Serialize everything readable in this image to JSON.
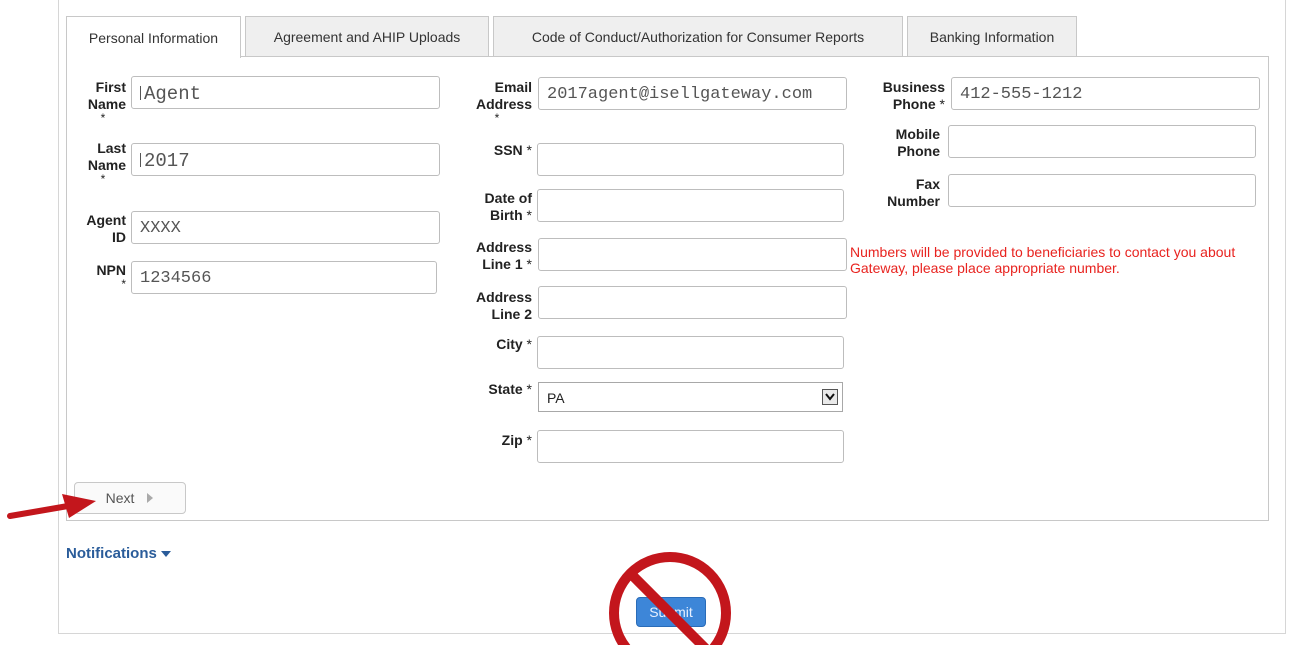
{
  "tabs": [
    {
      "label": "Personal Information",
      "active": true
    },
    {
      "label": "Agreement and AHIP Uploads",
      "active": false
    },
    {
      "label": "Code of Conduct/Authorization for Consumer Reports",
      "active": false
    },
    {
      "label": "Banking Information",
      "active": false
    }
  ],
  "form": {
    "first_name": {
      "label_1": "First",
      "label_2": "Name",
      "required": "*",
      "value": "Agent"
    },
    "last_name": {
      "label_1": "Last",
      "label_2": "Name",
      "required": "*",
      "value": "2017"
    },
    "agent_id": {
      "label_1": "Agent",
      "label_2": "ID",
      "value": "XXXX"
    },
    "npn": {
      "label_1": "NPN",
      "required": "*",
      "value": "1234566"
    },
    "email": {
      "label_1": "Email",
      "label_2": "Address",
      "required": "*",
      "value": "2017agent@isellgateway.com"
    },
    "ssn": {
      "label": "SSN",
      "required": "*",
      "value": ""
    },
    "dob": {
      "label_1": "Date of",
      "label_2": "Birth",
      "required": "*",
      "value": ""
    },
    "address1": {
      "label_1": "Address",
      "label_2": "Line 1",
      "required": "*",
      "value": ""
    },
    "address2": {
      "label_1": "Address",
      "label_2": "Line 2",
      "value": ""
    },
    "city": {
      "label": "City",
      "required": "*",
      "value": ""
    },
    "state": {
      "label": "State",
      "required": "*",
      "value": "PA"
    },
    "zip": {
      "label": "Zip",
      "required": "*",
      "value": ""
    },
    "business_phone": {
      "label_1": "Business",
      "label_2": "Phone",
      "required": "*",
      "value": "412-555-1212"
    },
    "mobile_phone": {
      "label_1": "Mobile",
      "label_2": "Phone",
      "value": ""
    },
    "fax": {
      "label_1": "Fax",
      "label_2": "Number",
      "value": ""
    }
  },
  "notice": "Numbers will be provided to beneficiaries to contact you about Gateway, please place appropriate number.",
  "buttons": {
    "next": "Next",
    "submit": "Submit"
  },
  "notifications": {
    "label": "Notifications"
  },
  "colors": {
    "annotation_red": "#c3161c",
    "link_blue": "#2a5c9a",
    "notice_red": "#e8231f",
    "submit_blue": "#3d86d8"
  },
  "icons": {
    "next": "play-right-icon",
    "dropdown": "chevron-down-icon",
    "notifications": "caret-down-icon",
    "annotation": "arrow-annotation",
    "prohibited": "no-sign-icon"
  }
}
